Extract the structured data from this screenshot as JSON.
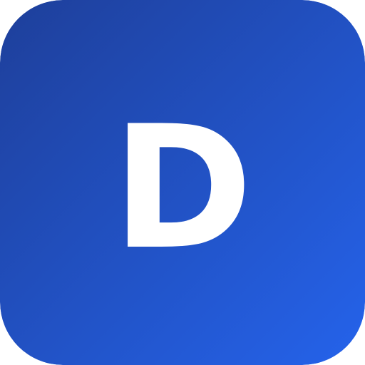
{
  "icon": {
    "name": "app-icon",
    "letter": "D",
    "colors": {
      "gradient_start": "#1e3f9a",
      "gradient_end": "#2563eb",
      "letter": "#ffffff"
    }
  }
}
